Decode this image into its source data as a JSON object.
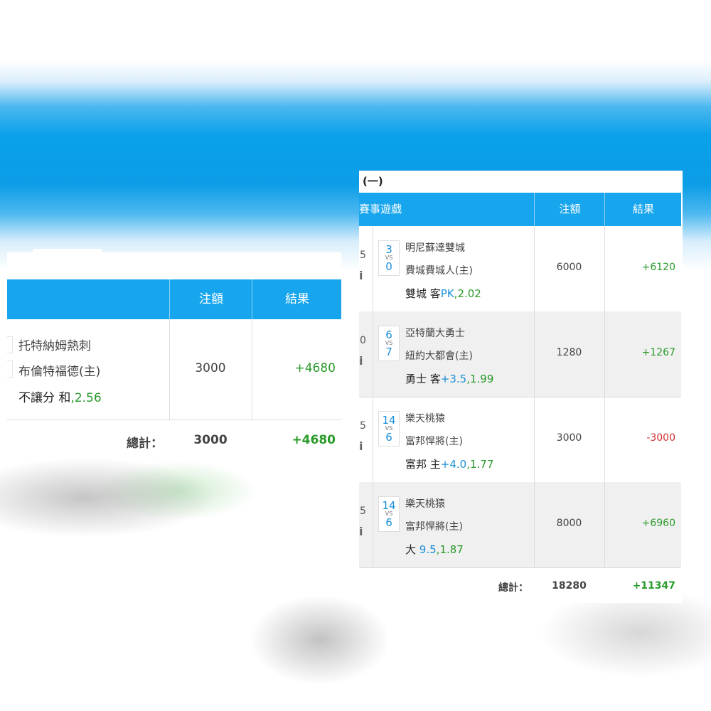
{
  "left_card": {
    "header": {
      "col_amount": "注額",
      "col_result": "結果"
    },
    "row": {
      "team1": "托特納姆熱刺",
      "team2": "布倫特福德(主)",
      "bet_label": "不讓分 和",
      "bet_comma": ",",
      "odds": "2.56",
      "amount": "3000",
      "result": "+4680"
    },
    "total": {
      "label": "總計：",
      "amount": "3000",
      "result": "+4680"
    }
  },
  "right_card": {
    "title": "(一)",
    "header": {
      "col_game": "賽事遊戲",
      "col_amount": "注額",
      "col_result": "結果"
    },
    "rows": [
      {
        "edge_num": "5",
        "edge_icon": "i",
        "score_home": "3",
        "vs": "VS",
        "score_away": "0",
        "team1": "明尼蘇達雙城",
        "team2": "費城費城人(主)",
        "bet_team": "雙城 客",
        "bet_line": "PK",
        "bet_comma": ",",
        "odds": "2.02",
        "amount": "6000",
        "result": "+6120",
        "result_status": "win"
      },
      {
        "edge_num": "0",
        "edge_icon": "i",
        "score_home": "6",
        "vs": "VS",
        "score_away": "7",
        "team1": "亞特蘭大勇士",
        "team2": "紐約大都會(主)",
        "bet_team": "勇士 客",
        "bet_line": "+3.5",
        "bet_comma": ",",
        "odds": "1.99",
        "amount": "1280",
        "result": "+1267",
        "result_status": "win"
      },
      {
        "edge_num": "5",
        "edge_icon": "i",
        "score_home": "14",
        "vs": "VS",
        "score_away": "6",
        "team1": "樂天桃猿",
        "team2": "富邦悍將(主)",
        "bet_team": "富邦 主",
        "bet_line": "+4.0",
        "bet_comma": ",",
        "odds": "1.77",
        "amount": "3000",
        "result": "-3000",
        "result_status": "loss"
      },
      {
        "edge_num": "5",
        "edge_icon": "i",
        "score_home": "14",
        "vs": "VS",
        "score_away": "6",
        "team1": "樂天桃猿",
        "team2": "富邦悍將(主)",
        "bet_team": "大",
        "bet_line": "9.5",
        "bet_comma": ",",
        "odds": "1.87",
        "amount": "8000",
        "result": "+6960",
        "result_status": "win"
      }
    ],
    "total": {
      "label": "總計：",
      "amount": "18280",
      "result": "+11347"
    }
  },
  "colors": {
    "header_blue": "#17a6ee",
    "win_green": "#2a9a2a",
    "loss_red": "#d03030",
    "line_blue": "#1a8fd8"
  }
}
